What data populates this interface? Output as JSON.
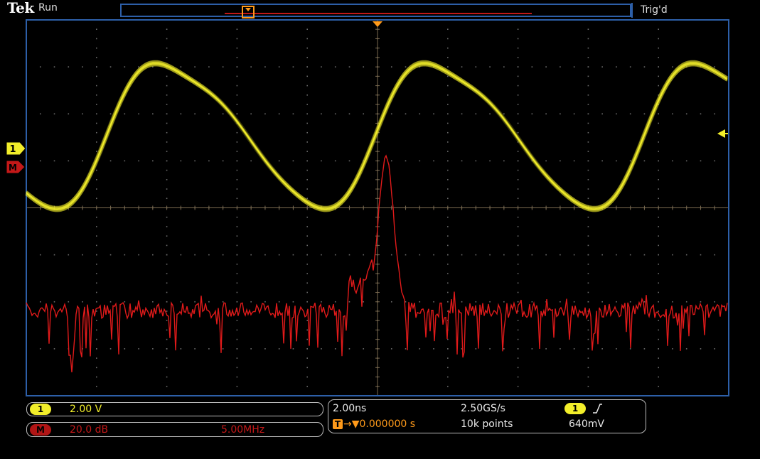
{
  "header": {
    "brand": "Tek",
    "acq_state": "Run",
    "trigger_state": "Trig'd"
  },
  "markers": {
    "ch1_label": "1",
    "math_label": "M",
    "trigger_pos_label": "T"
  },
  "colors": {
    "ch1": "#f2ee2a",
    "math": "#e01a1a",
    "trigger": "#ff9a1a",
    "grid": "#6c6c6c",
    "frame": "#2d5fa8"
  },
  "readouts": {
    "ch1": {
      "badge": "1",
      "scale": "2.00 V"
    },
    "math": {
      "badge": "M",
      "scale": "20.0 dB",
      "freq": "5.00MHz"
    },
    "horizontal": {
      "timebase": "2.00ns",
      "sample_rate": "2.50GS/s",
      "trigger_badge": "T",
      "delay": "→▼0.000000 s",
      "record_length": "10k points"
    },
    "trigger": {
      "badge": "1",
      "slope": "rising-slope-icon",
      "level": "640mV"
    }
  }
}
